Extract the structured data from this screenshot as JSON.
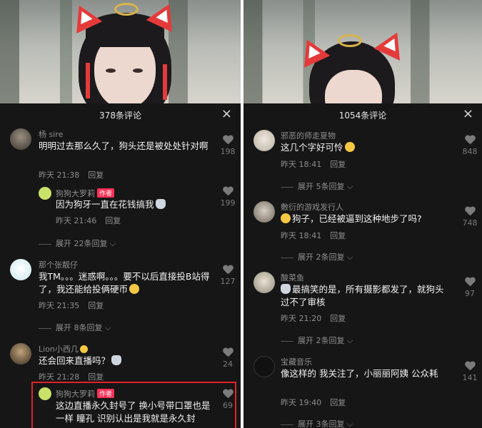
{
  "left": {
    "title": "378条评论",
    "close": "×",
    "comments": [
      {
        "user": "杨 sire",
        "text": "明明过去那么久了，狗头还是被处处针对啊",
        "time": "昨天 21:38",
        "reply": "回复",
        "likes": "198"
      },
      {
        "user": "狗狗大罗莉",
        "badge": "作者",
        "text": "因为狗牙一直在花钱搞我",
        "time": "昨天 21:46",
        "reply": "回复",
        "likes": "199"
      },
      {
        "user": "那个张靓仔",
        "text": "我TM。。。迷惑啊。。。要不以后直接投B站得了，我还能给投俩硬币",
        "time": "昨天 21:35",
        "reply": "回复",
        "likes": "127"
      },
      {
        "user": "Lion小西几",
        "text": "还会回来直播吗？",
        "time": "昨天 21:28",
        "reply": "回复",
        "likes": "24"
      },
      {
        "user": "狗狗大罗莉",
        "badge": "作者",
        "text": "这边直播永久封号了 换小号带口罩也是一样 瞳孔 识别认出是我就是永久封",
        "likes": "69"
      }
    ],
    "expands": [
      "展开 22条回复",
      "展开 8条回复"
    ]
  },
  "right": {
    "title": "1054条评论",
    "close": "×",
    "comments": [
      {
        "user": "邪恶的师走夏物",
        "text": "这几个字好可怜",
        "time": "昨天 18:41",
        "reply": "回复",
        "likes": "848"
      },
      {
        "user": "敷衍的游戏发行人",
        "text": "狗子，已经被逼到这种地步了吗?",
        "time": "昨天 18:41",
        "reply": "回复",
        "likes": "748"
      },
      {
        "user": "酸菜鱼",
        "text": "最搞笑的是，所有摄影都发了，就狗头过不了审核",
        "time": "昨天 21:20",
        "reply": "回复",
        "likes": "97"
      },
      {
        "user": "宝藏音乐",
        "text": "像这样的 我关注了，小丽丽阿姨 公众耗",
        "time": "昨天 19:40",
        "reply": "回复",
        "likes": "141"
      }
    ],
    "expands": [
      "展开 5条回复",
      "展开 2条回复",
      "展开 2条回复",
      "展开 3条回复"
    ]
  },
  "colors": {
    "background": "#161616",
    "text": "#f2f2f2",
    "meta": "#8e8e8e",
    "badge": "#ff2f55",
    "highlight": "#e0222a"
  }
}
